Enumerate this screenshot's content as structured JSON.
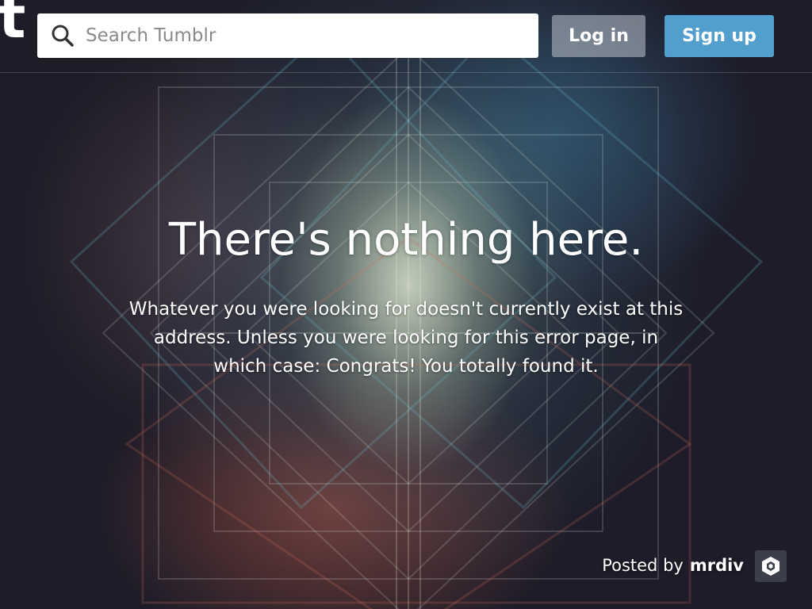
{
  "header": {
    "logo_letter": "t",
    "search": {
      "placeholder": "Search Tumblr",
      "value": ""
    },
    "login_label": "Log in",
    "signup_label": "Sign up"
  },
  "main": {
    "headline": "There's nothing here.",
    "message": "Whatever you were looking for doesn't currently exist at this address. Unless you were looking for this error page, in which case: Congrats! You totally found it."
  },
  "credit": {
    "prefix": "Posted by",
    "author": "mrdiv"
  },
  "colors": {
    "signup_button": "#529ecc",
    "background": "#1d1c28"
  },
  "icons": [
    "tumblr-logo",
    "search-icon",
    "avatar-icon"
  ]
}
